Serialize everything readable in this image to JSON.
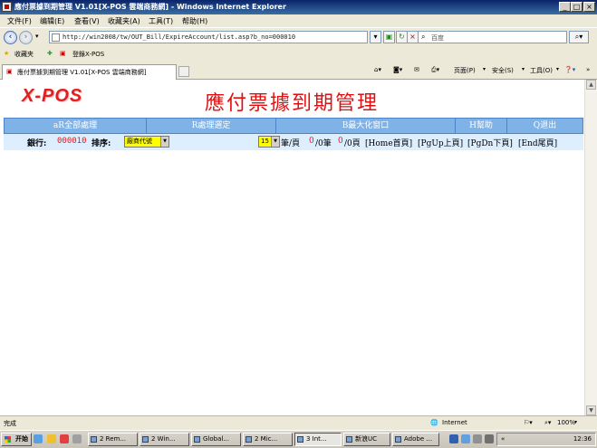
{
  "window": {
    "title": "應付票據到期管理 V1.01[X-POS 雲端商務網] - Windows Internet Explorer"
  },
  "menu": {
    "items": [
      "文件(F)",
      "编辑(E)",
      "查看(V)",
      "收藏夹(A)",
      "工具(T)",
      "帮助(H)"
    ]
  },
  "address": {
    "url": "http://win2008/tw/OUT_Bill/ExpireAccount/list.asp?b_no=000010",
    "search_placeholder": "百度"
  },
  "favorites": {
    "label": "收藏夹",
    "link": "登錄X-POS"
  },
  "tab": {
    "title": "應付票據到期管理 V1.01[X-POS 雲端商務網]"
  },
  "command_bar": {
    "page": "页面(P)",
    "safety": "安全(S)",
    "tools": "工具(O)"
  },
  "page": {
    "logo": "X-POS",
    "title": "應付票據到期管理"
  },
  "functions": [
    {
      "label": "aR全部處理"
    },
    {
      "label": "R處理選定"
    },
    {
      "label": "B最大化窗口"
    },
    {
      "label": "H幫助"
    },
    {
      "label": "Q退出"
    }
  ],
  "filter": {
    "bank_label": "銀行:",
    "bank_value": "000010",
    "sort_label": "排序:",
    "sort_selected": "廠商代號",
    "page_size": "15",
    "per_page": "筆/頁",
    "total_records": "0",
    "records_label": "/0筆",
    "current_page": "0",
    "pages_label": "/0頁",
    "nav_home": "[Home首頁]",
    "nav_pgup": "[PgUp上頁]",
    "nav_pgdn": "[PgDn下頁]",
    "nav_end": "[End尾頁]"
  },
  "status": {
    "text": "完成",
    "zone": "Internet",
    "zoom": "100%"
  },
  "taskbar": {
    "start": "开始",
    "tasks": [
      "2 Rem...",
      "2 Win...",
      "Global...",
      "2 Mic...",
      "3 Int...",
      "新浪UC",
      "Adobe ..."
    ],
    "clock": "12:36"
  }
}
